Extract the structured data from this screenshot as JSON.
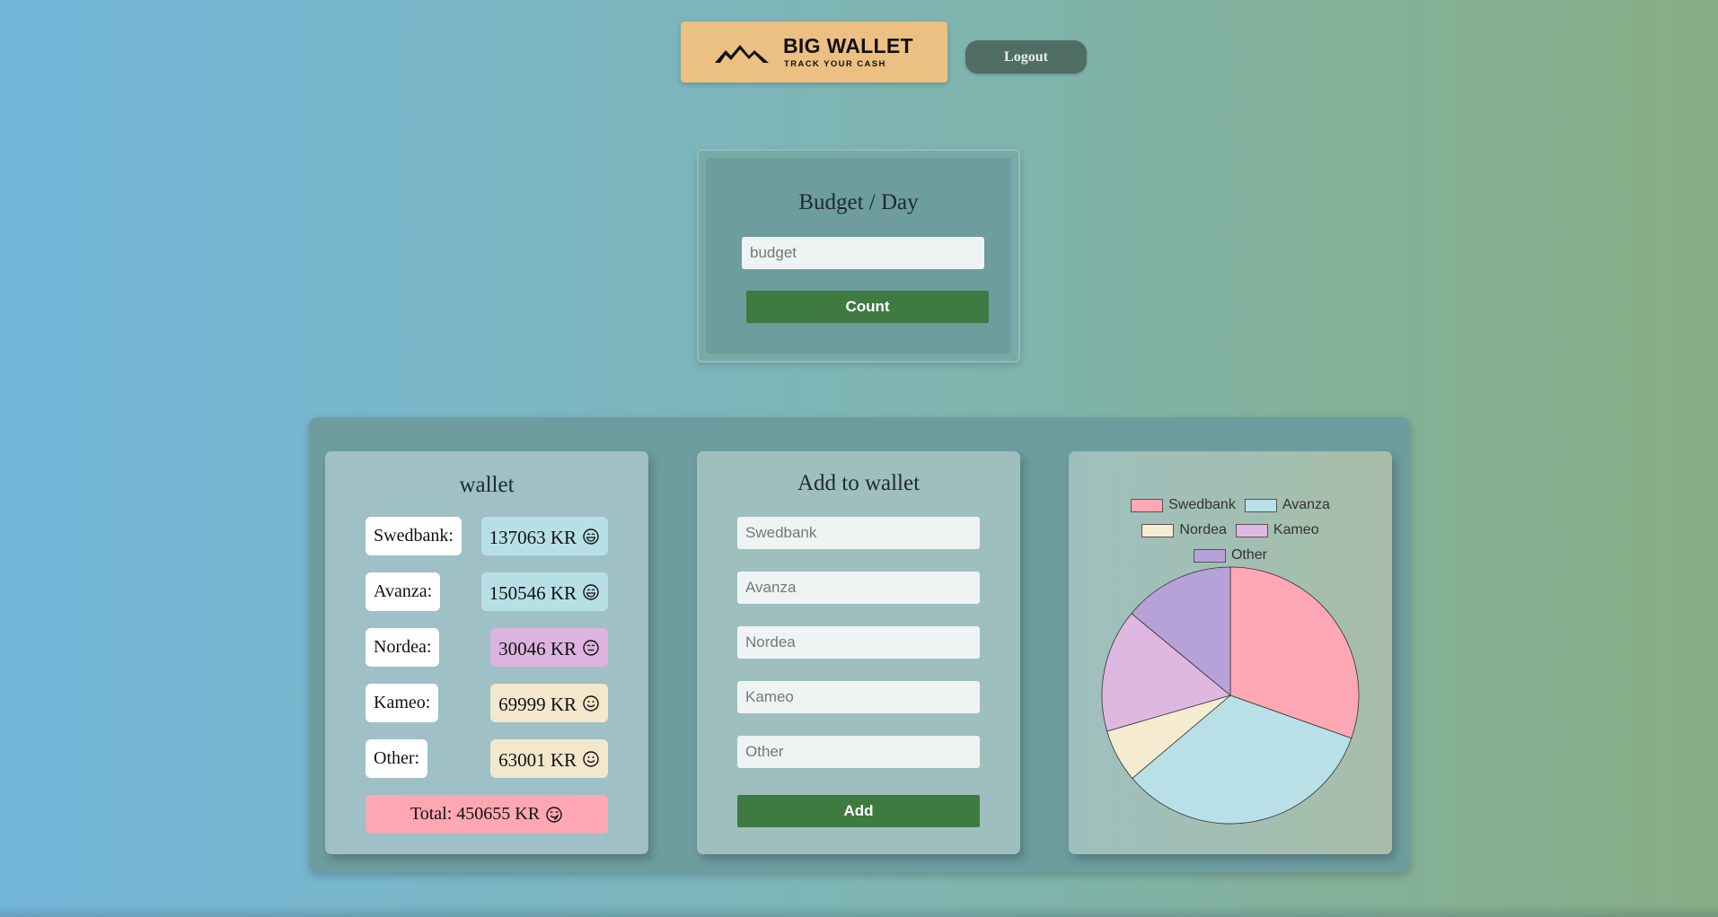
{
  "header": {
    "logo_title": "BIG WALLET",
    "logo_subtitle": "TRACK YOUR CASH",
    "logout_label": "Logout"
  },
  "budget": {
    "title": "Budget / Day",
    "placeholder": "budget",
    "button_label": "Count"
  },
  "wallet": {
    "title": "wallet",
    "rows": [
      {
        "label": "Swedbank:",
        "value": "137063 KR",
        "color": "#b7e0e6",
        "mood": "grin"
      },
      {
        "label": "Avanza:",
        "value": "150546 KR",
        "color": "#b7e0e6",
        "mood": "grin"
      },
      {
        "label": "Nordea:",
        "value": "30046 KR",
        "color": "#dcb4df",
        "mood": "neutral"
      },
      {
        "label": "Kameo:",
        "value": "69999 KR",
        "color": "#f3e8cc",
        "mood": "smile"
      },
      {
        "label": "Other:",
        "value": "63001 KR",
        "color": "#f3e8cc",
        "mood": "smile"
      }
    ],
    "total": "Total: 450655 KR",
    "total_color": "#ffa7b2"
  },
  "add": {
    "title": "Add to wallet",
    "placeholders": [
      "Swedbank",
      "Avanza",
      "Nordea",
      "Kameo",
      "Other"
    ],
    "button_label": "Add"
  },
  "chart_data": {
    "type": "pie",
    "labels": [
      "Swedbank",
      "Avanza",
      "Nordea",
      "Kameo",
      "Other"
    ],
    "values": [
      137063,
      150546,
      30046,
      69999,
      63001
    ],
    "colors": [
      "#ffa7b4",
      "#b8e0e6",
      "#f4ebd0",
      "#dfb8e2",
      "#b7a2d8"
    ],
    "legend": "top"
  }
}
